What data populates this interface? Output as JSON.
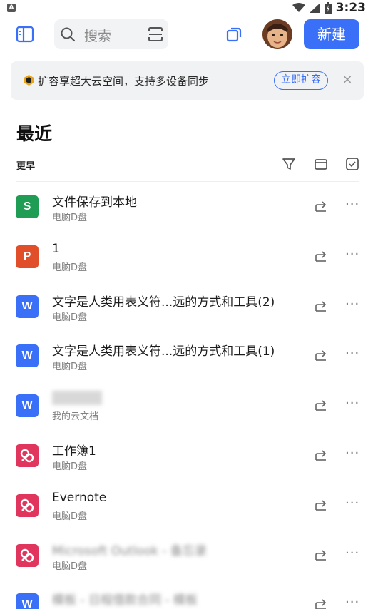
{
  "status_bar": {
    "time": "3:23",
    "left_badge": "A"
  },
  "topbar": {
    "search_placeholder": "搜索",
    "new_button": "新建"
  },
  "banner": {
    "text": "扩容享超大云空间，支持多设备同步",
    "action": "立即扩容",
    "close": "×"
  },
  "section": {
    "title": "最近",
    "group": "更早"
  },
  "colors": {
    "accent": "#3a6ff7",
    "sheet": "#1f9d55",
    "slide": "#e04e2a",
    "word": "#3a6ff7",
    "pdf": "#e0365e"
  },
  "files": [
    {
      "name": "文件保存到本地",
      "location": "电脑D盘",
      "icon": "S",
      "type": "sheet",
      "blurred": false
    },
    {
      "name": "1",
      "location": "电脑D盘",
      "icon": "P",
      "type": "slide",
      "blurred": false
    },
    {
      "name": "文字是人类用表义符...远的方式和工具(2)",
      "location": "电脑D盘",
      "icon": "W",
      "type": "word",
      "blurred": false
    },
    {
      "name": "文字是人类用表义符...远的方式和工具(1)",
      "location": "电脑D盘",
      "icon": "W",
      "type": "word",
      "blurred": false
    },
    {
      "name": "",
      "location": "我的云文档",
      "icon": "W",
      "type": "word",
      "blurred": true
    },
    {
      "name": "工作簿1",
      "location": "电脑D盘",
      "icon": "P",
      "type": "pdf",
      "blurred": false
    },
    {
      "name": "Evernote",
      "location": "电脑D盘",
      "icon": "P",
      "type": "pdf",
      "blurred": false
    },
    {
      "name": "Microsoft Outlook - 备忘录",
      "location": "电脑D盘",
      "icon": "P",
      "type": "pdf",
      "blurred": true
    },
    {
      "name": "模板 - 日程借款合同 - 模板",
      "location": "",
      "icon": "W",
      "type": "word",
      "blurred": true
    }
  ],
  "more_label": "···"
}
